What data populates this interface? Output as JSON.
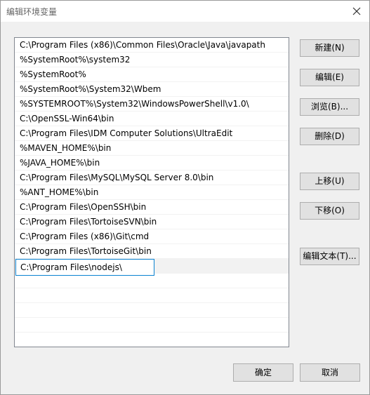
{
  "window": {
    "title": "编辑环境变量"
  },
  "paths": [
    "C:\\Program Files (x86)\\Common Files\\Oracle\\Java\\javapath",
    "%SystemRoot%\\system32",
    "%SystemRoot%",
    "%SystemRoot%\\System32\\Wbem",
    "%SYSTEMROOT%\\System32\\WindowsPowerShell\\v1.0\\",
    "C:\\OpenSSL-Win64\\bin",
    "C:\\Program Files\\IDM Computer Solutions\\UltraEdit",
    "%MAVEN_HOME%\\bin",
    "%JAVA_HOME%\\bin",
    "C:\\Program Files\\MySQL\\MySQL Server 8.0\\bin",
    "%ANT_HOME%\\bin",
    "C:\\Program Files\\OpenSSH\\bin",
    "C:\\Program Files\\TortoiseSVN\\bin",
    "C:\\Program Files (x86)\\Git\\cmd",
    "C:\\Program Files\\TortoiseGit\\bin"
  ],
  "editing_value": "C:\\Program Files\\nodejs\\",
  "buttons": {
    "new": "新建(N)",
    "edit": "编辑(E)",
    "browse": "浏览(B)...",
    "delete": "删除(D)",
    "move_up": "上移(U)",
    "move_down": "下移(O)",
    "edit_text": "编辑文本(T)...",
    "ok": "确定",
    "cancel": "取消"
  }
}
